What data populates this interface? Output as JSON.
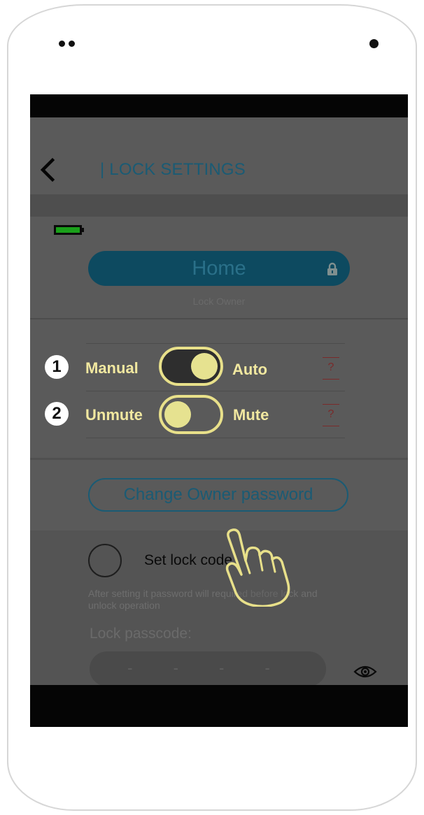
{
  "app": {
    "title": "| LOCK SETTINGS",
    "back_icon": "chevron-left-icon",
    "battery_icon": "battery-icon",
    "battery_color": "#1aa01a"
  },
  "lock": {
    "name": "Home",
    "owner_label": "Lock Owner",
    "lock_icon": "lock-icon"
  },
  "settings": [
    {
      "number": "1",
      "left_label": "Manual",
      "right_label": "Auto",
      "help": "?",
      "state": "on"
    },
    {
      "number": "2",
      "left_label": "Unmute",
      "right_label": "Mute",
      "help": "?",
      "state": "off"
    }
  ],
  "buttons": {
    "change_owner_password": "Change Owner password"
  },
  "lock_code": {
    "label": "Set lock code",
    "hint": "After setting it password will required before lock and unlock operation",
    "passcode_label": "Lock passcode:",
    "passcode_placeholder": "- - - -",
    "visibility_icon": "eye-icon"
  },
  "overlay": {
    "gesture_icon": "tap-hand-icon",
    "highlight_color": "#e8e08a"
  },
  "colors": {
    "accent": "#1a5b74",
    "overlay_text": "#f1e8a0",
    "help_red": "#7a2a2a"
  }
}
